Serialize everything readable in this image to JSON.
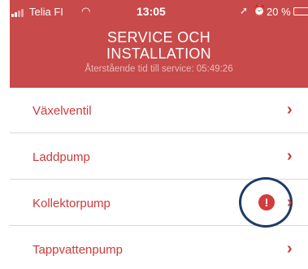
{
  "status_bar": {
    "carrier": "Telia FI",
    "time": "13:05",
    "battery": "20 %",
    "battery_level": 0.2,
    "icons": [
      "signal-icon",
      "wifi-icon",
      "location-icon",
      "alarm-icon",
      "battery-icon"
    ]
  },
  "header": {
    "title_line1": "SERVICE OCH",
    "title_line2": "INSTALLATION",
    "subtitle": "Återstående tid till service: 05:49:26",
    "background": "#c84a4a"
  },
  "menu": {
    "items": [
      {
        "label": "Växelventil"
      },
      {
        "label": "Laddpump"
      },
      {
        "label": "Kollektorpump",
        "warning": "!"
      },
      {
        "label": "Tappvattenpump"
      }
    ],
    "chevron": "›",
    "accent": "#cc3b3b",
    "warning_color": "#d13c3c",
    "highlight_ring_color": "#1f3a66"
  }
}
